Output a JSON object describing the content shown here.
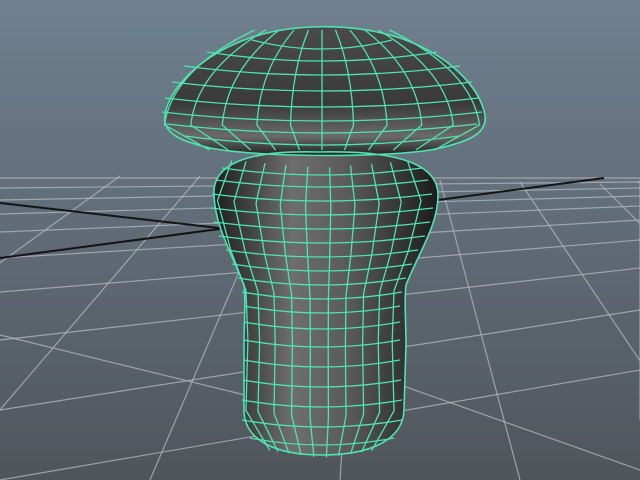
{
  "viewport": {
    "background_top": "#6f8090",
    "background_bottom": "#50555b",
    "grid_color": "#aeb5bb",
    "axis_color": "#141414",
    "wire_color": "#4fe3b0",
    "mesh_shade_light": "#8e8e8e",
    "mesh_shade_dark": "#2c2c2c"
  },
  "object": {
    "name_icon": "mushroom-mesh",
    "display_mode": "wireframe-on-shaded",
    "selected": true
  }
}
